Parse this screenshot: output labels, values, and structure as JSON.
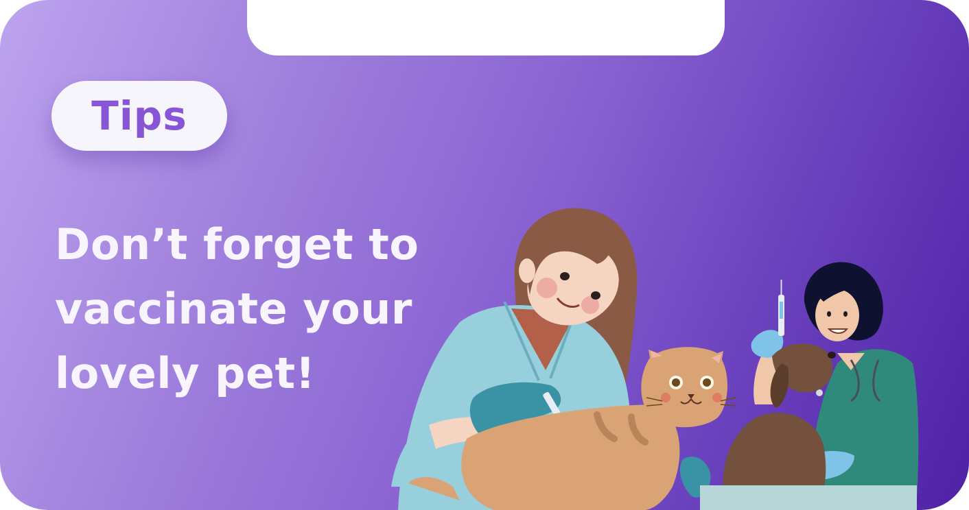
{
  "badge": {
    "label": "Tips"
  },
  "headline": {
    "lines": [
      "Don’t forget to",
      "vaccinate your",
      "lovely pet!"
    ]
  },
  "colors": {
    "gradient_start": "#bda3ef",
    "gradient_end": "#4f21a6",
    "badge_text": "#8755d6",
    "headline_text": "#f8f5ff",
    "scrub_blue": "#97cfdc",
    "scrub_green": "#2f8a7c",
    "glove_teal": "#3a93a5",
    "glove_blue": "#7fc3e8",
    "cat": "#d9a375",
    "dog": "#74513d"
  },
  "illustration": {
    "subject": "vet-vaccinating-cat-and-dog"
  }
}
